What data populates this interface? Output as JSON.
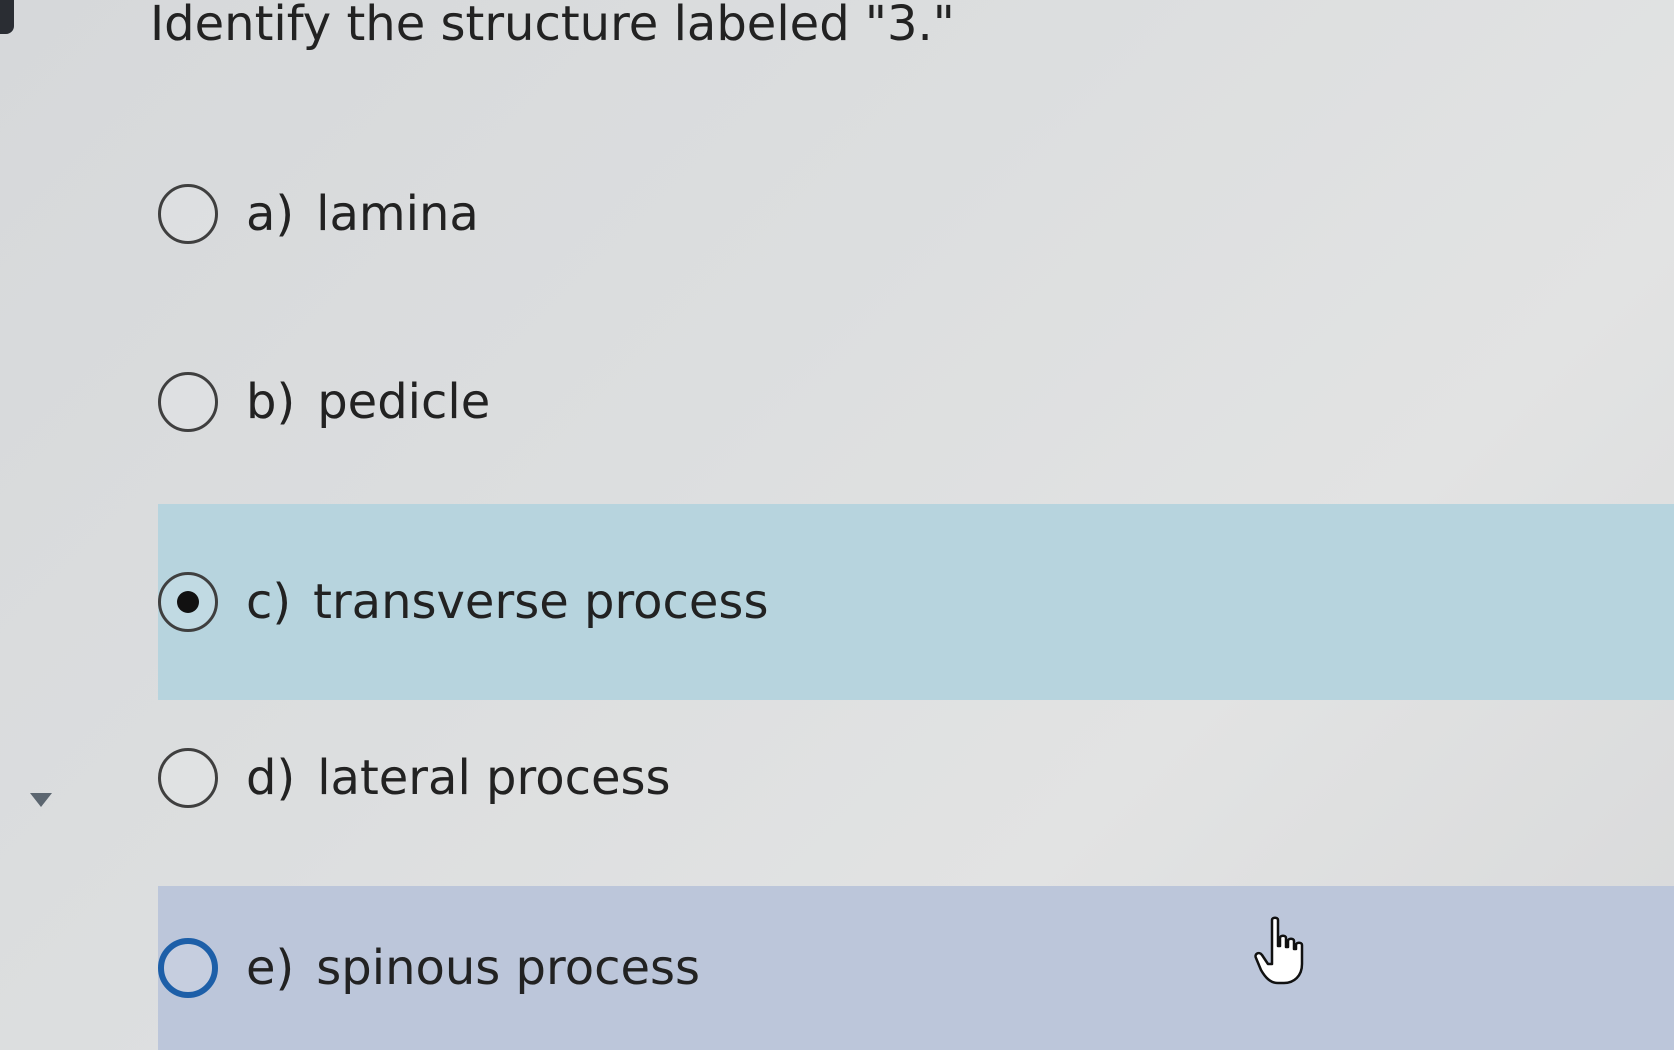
{
  "question": {
    "text": "Identify the structure labeled \"3.\""
  },
  "options": [
    {
      "letter": "a)",
      "text": "lamina",
      "selected": false
    },
    {
      "letter": "b)",
      "text": "pedicle",
      "selected": false
    },
    {
      "letter": "c)",
      "text": "transverse process",
      "selected": true
    },
    {
      "letter": "d)",
      "text": "lateral process",
      "selected": false
    },
    {
      "letter": "e)",
      "text": "spinous process",
      "selected": false,
      "hovered": true
    }
  ],
  "colors": {
    "selected_row": "#b7d4de",
    "hovered_row": "#bcc6da",
    "focus_ring": "#1d5fa8"
  },
  "icons": {
    "collapse": "triangle-down-icon",
    "cursor": "hand-pointer-icon"
  }
}
